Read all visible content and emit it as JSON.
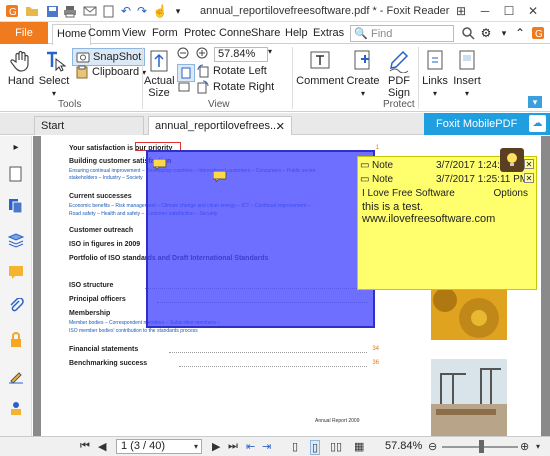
{
  "titlebar": {
    "title": "annual_reportilovefreesoftware.pdf * - Foxit Reader"
  },
  "menu": {
    "file": "File",
    "tabs": [
      "Home",
      "Comm",
      "View",
      "Form",
      "Protec",
      "Conne",
      "Share",
      "Help",
      "Extras"
    ],
    "find_placeholder": "Find"
  },
  "ribbon": {
    "hand": "Hand",
    "select": "Select",
    "snapshot": "SnapShot",
    "clipboard": "Clipboard",
    "actual_size_1": "Actual",
    "actual_size_2": "Size",
    "zoom_value": "57.84%",
    "rotate_left": "Rotate Left",
    "rotate_right": "Rotate Right",
    "comment": "Comment",
    "create": "Create",
    "pdf_sign_1": "PDF",
    "pdf_sign_2": "Sign",
    "links": "Links",
    "insert": "Insert",
    "group_tools": "Tools",
    "group_view": "View",
    "group_protect": "Protect"
  },
  "doctabs": {
    "start": "Start",
    "current": "annual_reportilovefrees...",
    "mobile": "Foxit MobilePDF"
  },
  "page": {
    "toc": [
      {
        "type": "h",
        "text": "Your satisfaction is our priority",
        "page": "1"
      },
      {
        "type": "h",
        "text": "Building customer satisfaction",
        "page": ""
      },
      {
        "type": "s",
        "text": "Ensuring continual improvement – Developing countries – International customers – Consumers – Public sector",
        "page": ""
      },
      {
        "type": "s",
        "text": "stakeholders – Industry – Society",
        "page": ""
      },
      {
        "type": "h",
        "text": "Current successes",
        "page": ""
      },
      {
        "type": "s",
        "text": "Economic benefits – Risk management – Climate change and clean energy – ICT – Continual improvement –",
        "page": ""
      },
      {
        "type": "s",
        "text": "Road safety – Health and safety – Customer satisfaction – Security",
        "page": ""
      },
      {
        "type": "h",
        "text": "Customer outreach",
        "page": ""
      },
      {
        "type": "h",
        "text": "ISO in figures in 2009",
        "page": ""
      },
      {
        "type": "h",
        "text": "Portfolio of ISO standards and Draft International Standards",
        "page": ""
      },
      {
        "type": "h",
        "text": "ISO structure",
        "page": ""
      },
      {
        "type": "h",
        "text": "Principal officers",
        "page": ""
      },
      {
        "type": "h",
        "text": "Membership",
        "page": ""
      },
      {
        "type": "s",
        "text": "Member bodies – Correspondent members – Subscriber members –",
        "page": ""
      },
      {
        "type": "s",
        "text": "ISO member bodies' contribution to the standards process",
        "page": ""
      },
      {
        "type": "h",
        "text": "Financial statements",
        "page": "34"
      },
      {
        "type": "h",
        "text": "Benchmarking success",
        "page": "36"
      }
    ],
    "footer": "Annual Report 2009"
  },
  "note": {
    "label1": "Note",
    "date1": "3/7/2017 1:24:",
    "label2": "Note",
    "date2": "3/7/2017 1:25:11 PM",
    "author": "I Love Free Software",
    "options": "Options",
    "line1": "this is a test.",
    "line2": "www.ilovefreesoftware.com"
  },
  "status": {
    "page_value": "1 (3 / 40)",
    "zoom": "57.84%"
  },
  "colors": {
    "accent": "#f07b1f",
    "mobile_blue": "#1f9ee0",
    "highlight": "#4646ff",
    "note_yellow": "#ffff6e"
  }
}
